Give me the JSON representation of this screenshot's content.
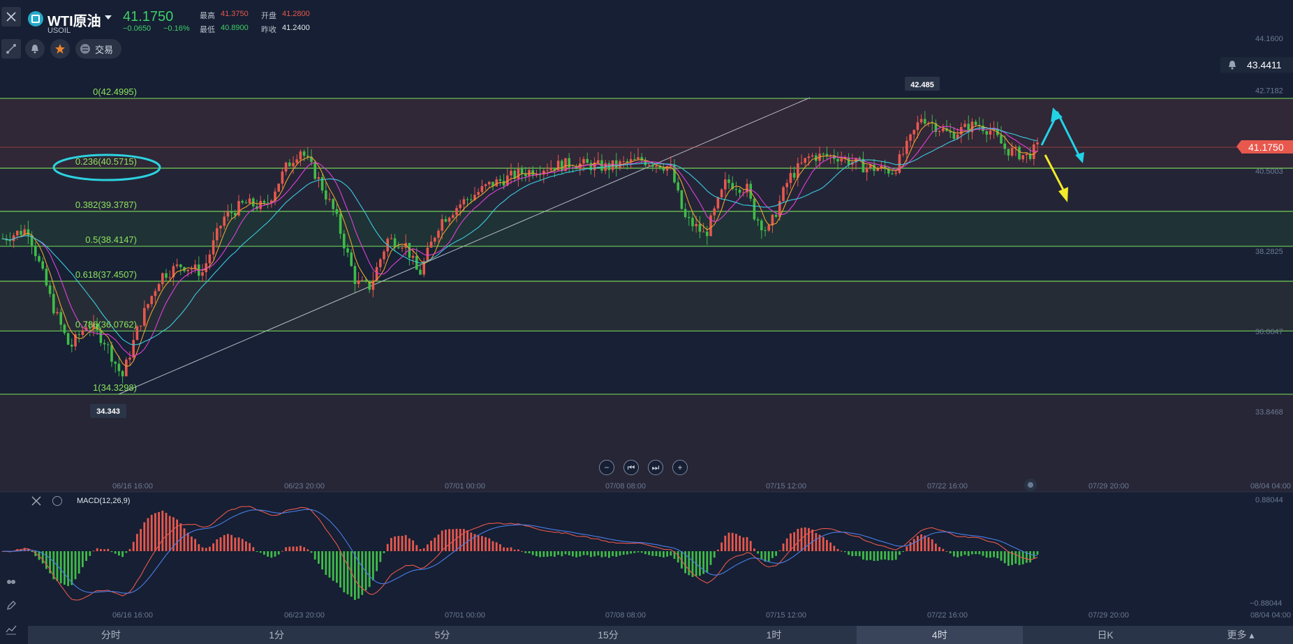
{
  "header": {
    "symbol_name": "WTI原油",
    "symbol_code": "USOIL",
    "last_price": "41.1750",
    "change": "−0.0650",
    "change_pct": "−0.16%",
    "stats": {
      "high_label": "最高",
      "high": "41.3750",
      "open_label": "开盘",
      "open": "41.2800",
      "low_label": "最低",
      "low": "40.8900",
      "prev_close_label": "昨收",
      "prev_close": "41.2400"
    },
    "trade_label": "交易"
  },
  "chart": {
    "price_axis_labels": [
      "44.1600",
      "42.7182",
      "40.5003",
      "38.2825",
      "36.0647",
      "33.8468"
    ],
    "time_axis_labels": [
      "06/16 16:00",
      "06/23 20:00",
      "07/01 00:00",
      "07/08 08:00",
      "07/15 12:00",
      "07/22 16:00",
      "07/29 20:00",
      "08/04 04:00"
    ],
    "alert_price": "43.4411",
    "current_price_tag": "41.1750",
    "high_marker": "42.485",
    "low_marker": "34.343",
    "fib_levels": [
      {
        "label": "0(42.4995)",
        "price": 42.4995
      },
      {
        "label": "0.236(40.5715)",
        "price": 40.5715
      },
      {
        "label": "0.382(39.3787)",
        "price": 39.3787
      },
      {
        "label": "0.5(38.4147)",
        "price": 38.4147
      },
      {
        "label": "0.618(37.4507)",
        "price": 37.4507
      },
      {
        "label": "0.786(36.0762)",
        "price": 36.0762
      },
      {
        "label": "1(34.3298)",
        "price": 34.3298
      }
    ],
    "nav_buttons": [
      "−",
      "⏮",
      "⏭",
      "+"
    ]
  },
  "macd": {
    "title": "MACD(12,26,9)",
    "axis_top": "0.88044",
    "axis_bottom": "−0.88044",
    "time_axis_labels": [
      "06/16 16:00",
      "06/23 20:00",
      "07/01 00:00",
      "07/08 08:00",
      "07/15 12:00",
      "07/22 16:00",
      "07/29 20:00",
      "08/04 04:00"
    ]
  },
  "periods": [
    {
      "label": "分时",
      "active": false
    },
    {
      "label": "1分",
      "active": false
    },
    {
      "label": "5分",
      "active": false
    },
    {
      "label": "15分",
      "active": false
    },
    {
      "label": "1时",
      "active": false
    },
    {
      "label": "4时",
      "active": true
    },
    {
      "label": "日K",
      "active": false
    }
  ],
  "more_label": "更多 ▴",
  "colors": {
    "background": "#161f33",
    "up": "#e8584d",
    "down": "#3fbb48",
    "fib_line": "#7de35a",
    "ma_fast": "#f0a030",
    "ma_mid": "#e23fd8",
    "ma_slow": "#3ccbe0",
    "macd_dif": "#e8584d",
    "macd_dea": "#4a7ee8",
    "arrow_cyan": "#22d3e6",
    "arrow_yellow": "#f2ea2a"
  }
}
